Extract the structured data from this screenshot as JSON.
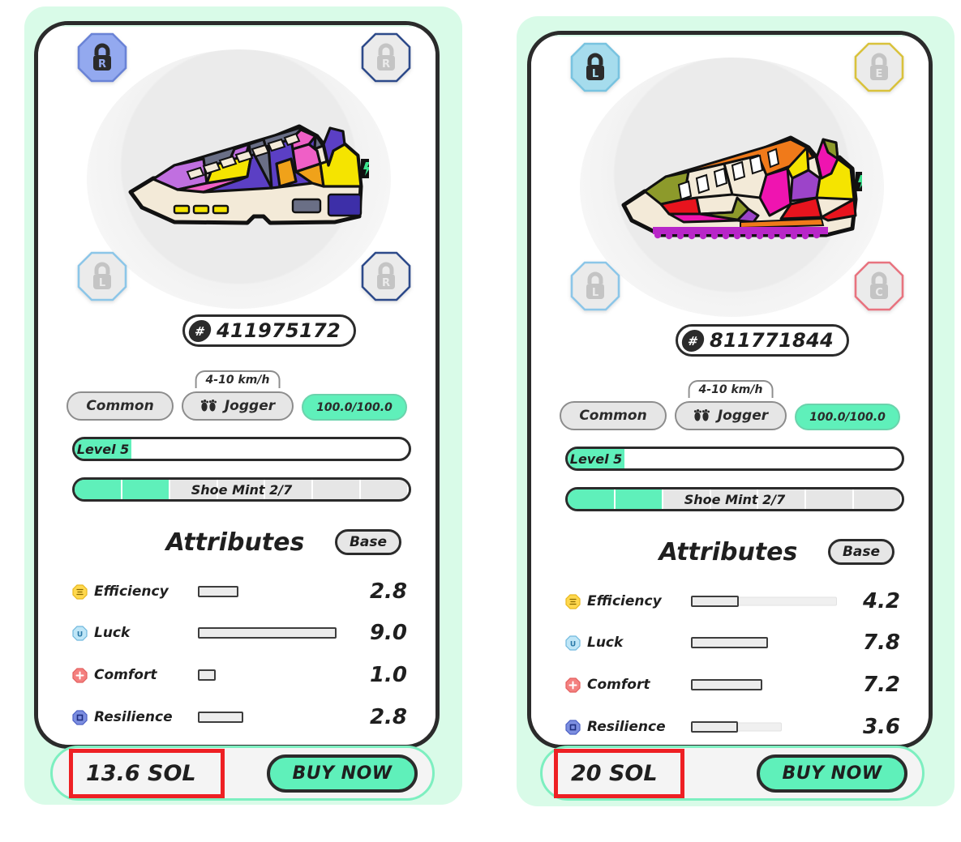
{
  "theme": {
    "mint_bg": "#d9fbe8",
    "mint_accent": "#5ff0ba",
    "frame_dark": "#2b2b2b",
    "highlight_red": "#ee2024",
    "chip_grey": "#e6e6e6"
  },
  "cards": [
    {
      "name": "left-shoe-card",
      "shoe_palette": [
        "#5b3fc4",
        "#c06fe0",
        "#ef5fc6",
        "#f5e400",
        "#f0a21a",
        "#6a6f86",
        "#f3ead8"
      ],
      "badges": [
        {
          "position": "top-left",
          "letter": "R",
          "state": "active",
          "fill": "#93a9ef",
          "stroke": "#6a83d6",
          "lock": "#2b2b2b"
        },
        {
          "position": "top-right",
          "letter": "R",
          "state": "locked",
          "fill": "#ebebeb",
          "stroke": "#2d4a8a",
          "lock": "#c4c4c4"
        },
        {
          "position": "bottom-left",
          "letter": "L",
          "state": "locked",
          "fill": "#ebebeb",
          "stroke": "#8cc6e8",
          "lock": "#c4c4c4"
        },
        {
          "position": "bottom-right",
          "letter": "R",
          "state": "locked",
          "fill": "#ebebeb",
          "stroke": "#2d4a8a",
          "lock": "#c4c4c4"
        }
      ],
      "id": "411975172",
      "id_prefix": "#",
      "chips": {
        "rarity": "Common",
        "type": "Jogger",
        "speed": "4-10 km/h",
        "energy": "100.0/100.0"
      },
      "level": {
        "label": "Level 5",
        "fill_pct": 17
      },
      "mint": {
        "label": "Shoe Mint 2/7",
        "filled": 2,
        "total": 7
      },
      "attributes_title": "Attributes",
      "base_label": "Base",
      "attributes": [
        {
          "name": "Efficiency",
          "value": "2.8",
          "fill_pct": 28,
          "track_pct": 0,
          "icon": "efficiency-icon",
          "icon_fill": "#ffd84d",
          "icon_stroke": "#e8b81f",
          "glyph": "lines"
        },
        {
          "name": "Luck",
          "value": "9.0",
          "fill_pct": 90,
          "track_pct": 0,
          "icon": "luck-icon",
          "icon_fill": "#bfe6f7",
          "icon_stroke": "#6fb8dd",
          "glyph": "U"
        },
        {
          "name": "Comfort",
          "value": "1.0",
          "fill_pct": 10,
          "track_pct": 0,
          "icon": "comfort-icon",
          "icon_fill": "#f4807f",
          "icon_stroke": "#e35f5e",
          "glyph": "plus"
        },
        {
          "name": "Resilience",
          "value": "2.8",
          "fill_pct": 28,
          "track_pct": 0,
          "icon": "resilience-icon",
          "icon_fill": "#7c8ee0",
          "icon_stroke": "#4c60c4",
          "glyph": "square"
        }
      ],
      "price": "13.6 SOL",
      "buy_label": "BUY NOW"
    },
    {
      "name": "right-shoe-card",
      "shoe_palette": [
        "#ef14b0",
        "#f5e400",
        "#e8141e",
        "#f07a1a",
        "#8d9a2b",
        "#9c44c9",
        "#f3ead8"
      ],
      "badges": [
        {
          "position": "top-left",
          "letter": "L",
          "state": "active",
          "fill": "#a6dced",
          "stroke": "#79c3e0",
          "lock": "#2b2b2b"
        },
        {
          "position": "top-right",
          "letter": "E",
          "state": "locked",
          "fill": "#ebebeb",
          "stroke": "#d9c23c",
          "lock": "#c4c4c4"
        },
        {
          "position": "bottom-left",
          "letter": "L",
          "state": "locked",
          "fill": "#ebebeb",
          "stroke": "#8cc6e8",
          "lock": "#c4c4c4"
        },
        {
          "position": "bottom-right",
          "letter": "C",
          "state": "locked",
          "fill": "#ebebeb",
          "stroke": "#e8737f",
          "lock": "#c4c4c4"
        }
      ],
      "id": "811771844",
      "id_prefix": "#",
      "chips": {
        "rarity": "Common",
        "type": "Jogger",
        "speed": "4-10 km/h",
        "energy": "100.0/100.0"
      },
      "level": {
        "label": "Level 5",
        "fill_pct": 17
      },
      "mint": {
        "label": "Shoe Mint 2/7",
        "filled": 2,
        "total": 7
      },
      "attributes_title": "Attributes",
      "base_label": "Base",
      "attributes": [
        {
          "name": "Efficiency",
          "value": "4.2",
          "fill_pct": 33,
          "track_pct": 100,
          "icon": "efficiency-icon",
          "icon_fill": "#ffd84d",
          "icon_stroke": "#e8b81f",
          "glyph": "lines"
        },
        {
          "name": "Luck",
          "value": "7.8",
          "fill_pct": 70,
          "track_pct": 0,
          "icon": "luck-icon",
          "icon_fill": "#bfe6f7",
          "icon_stroke": "#6fb8dd",
          "glyph": "U"
        },
        {
          "name": "Comfort",
          "value": "7.2",
          "fill_pct": 64,
          "track_pct": 0,
          "icon": "comfort-icon",
          "icon_fill": "#f4807f",
          "icon_stroke": "#e35f5e",
          "glyph": "plus"
        },
        {
          "name": "Resilience",
          "value": "3.6",
          "fill_pct": 32,
          "track_pct": 62,
          "icon": "resilience-icon",
          "icon_fill": "#7c8ee0",
          "icon_stroke": "#4c60c4",
          "glyph": "square"
        }
      ],
      "price": "20 SOL",
      "buy_label": "BUY NOW"
    }
  ]
}
